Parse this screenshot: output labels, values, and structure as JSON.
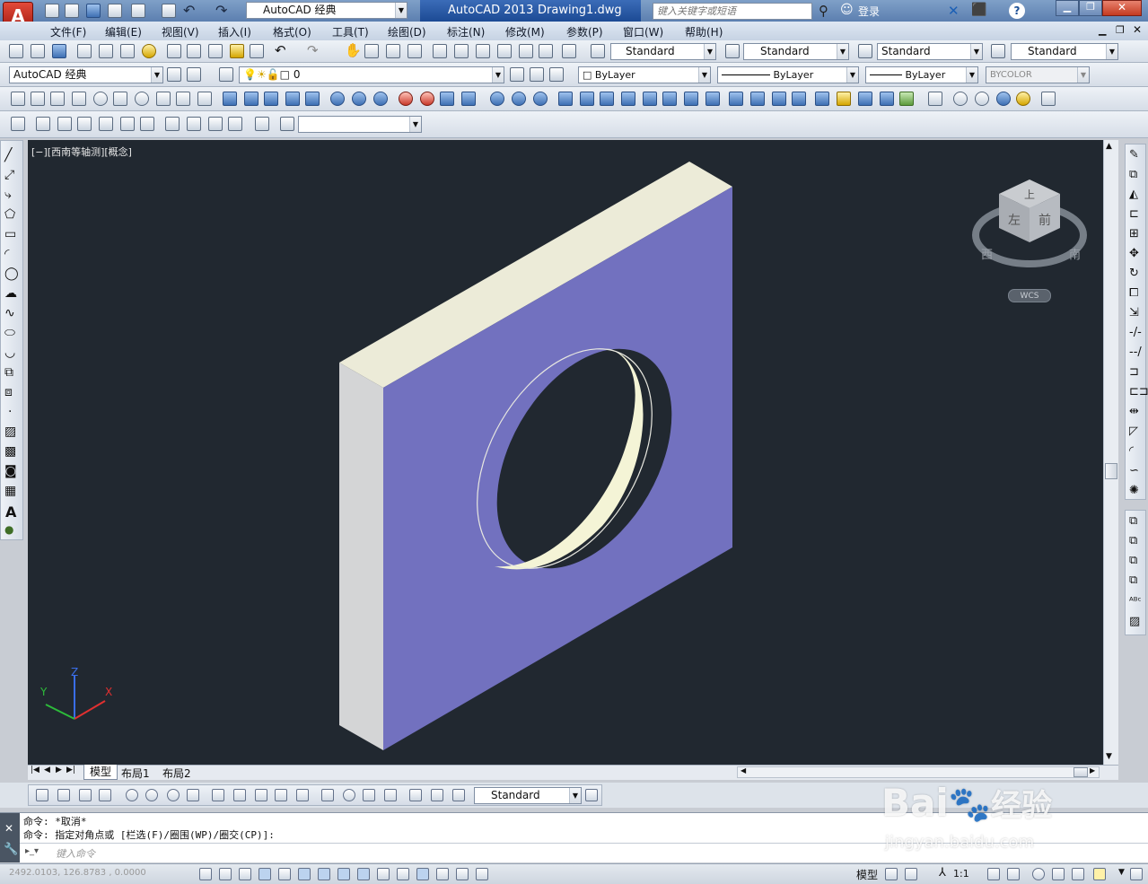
{
  "titlebar": {
    "workspace": "AutoCAD 经典",
    "app_title": "AutoCAD 2013",
    "doc_title": "Drawing1.dwg",
    "search_placeholder": "键入关键字或短语",
    "login": "登录"
  },
  "menu": [
    "文件(F)",
    "编辑(E)",
    "视图(V)",
    "插入(I)",
    "格式(O)",
    "工具(T)",
    "绘图(D)",
    "标注(N)",
    "修改(M)",
    "参数(P)",
    "窗口(W)",
    "帮助(H)"
  ],
  "styles": {
    "text_style": "Standard",
    "dim_style": "Standard",
    "table_style": "Standard",
    "mleader_style": "Standard"
  },
  "workspace_combo": "AutoCAD 经典",
  "layer": {
    "name": "0"
  },
  "properties": {
    "color": "ByLayer",
    "linetype": "ByLayer",
    "lineweight": "ByLayer",
    "plotstyle": "BYCOLOR"
  },
  "viewport": {
    "label": "[−][西南等轴测][概念]",
    "viewcube": {
      "top": "上",
      "left": "左",
      "front": "前",
      "west": "西",
      "south": "南",
      "ucs": "WCS"
    },
    "axes": {
      "x": "X",
      "y": "Y",
      "z": "Z"
    }
  },
  "tabs": [
    "模型",
    "布局1",
    "布局2"
  ],
  "dim_style_combo": "Standard",
  "command": {
    "history": [
      "命令: *取消*",
      "命令: 指定对角点或 [栏选(F)/圈围(WP)/圈交(CP)]:"
    ],
    "input_placeholder": "键入命令"
  },
  "status": {
    "coords": "2492.0103, 126.8783 , 0.0000",
    "model": "模型",
    "scale": "1:1"
  },
  "watermark": {
    "brand": "Bai",
    "brand2": "经验",
    "url": "jingyan.baidu.com"
  }
}
